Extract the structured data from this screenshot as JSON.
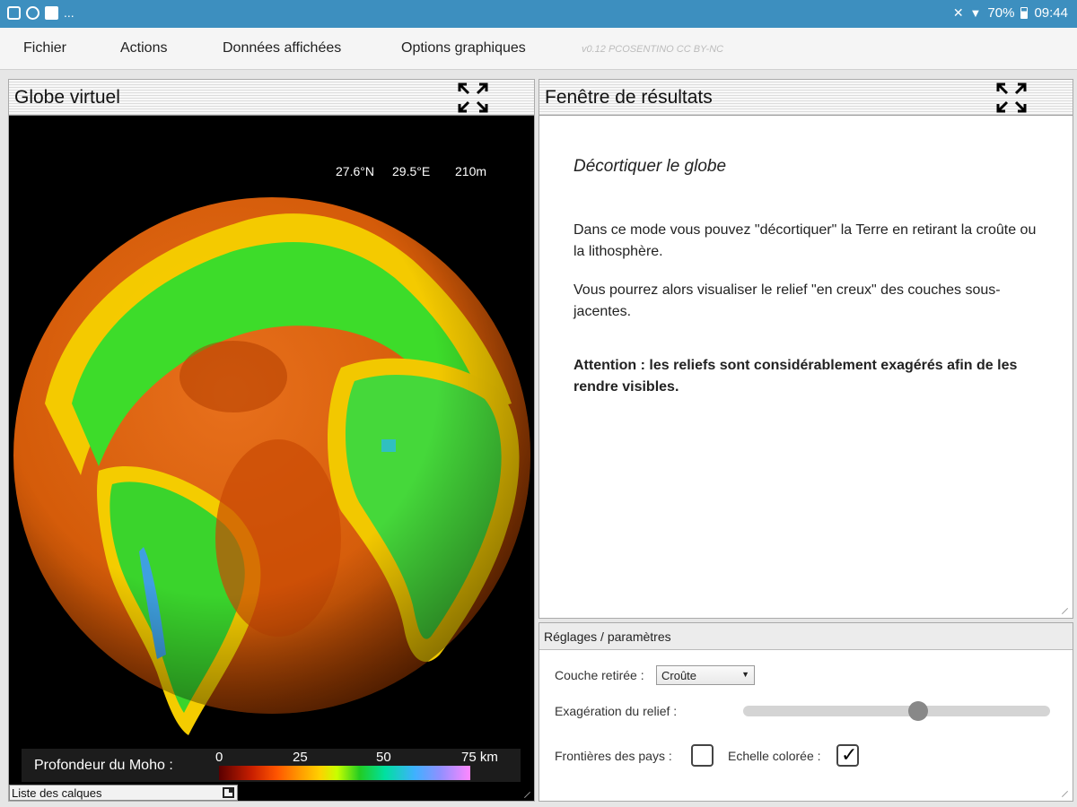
{
  "status_bar": {
    "notification_overflow": "...",
    "battery_percent": "70%",
    "time": "09:44"
  },
  "menu": {
    "items": [
      "Fichier",
      "Actions",
      "Données affichées",
      "Options graphiques"
    ],
    "version": "v0.12 PCOSENTINO CC BY-NC"
  },
  "globe_panel": {
    "title": "Globe virtuel",
    "coords": {
      "lat": "27.6°N",
      "lon": "29.5°E",
      "alt": "210m"
    },
    "legend": {
      "label": "Profondeur du Moho :",
      "ticks": [
        "0",
        "25",
        "50",
        "75 km"
      ]
    },
    "layers_label": "Liste des calques"
  },
  "results_panel": {
    "title": "Fenêtre de résultats",
    "heading": "Décortiquer le globe",
    "paragraphs": [
      "Dans ce mode vous pouvez \"décortiquer\" la Terre en retirant la croûte ou la lithosphère.",
      "Vous pourrez alors visualiser le relief \"en creux\" des couches sous-jacentes."
    ],
    "warning": "Attention : les reliefs sont considérablement exagérés afin de les rendre visibles."
  },
  "settings_panel": {
    "title": "Réglages / paramètres",
    "layer_removed_label": "Couche retirée :",
    "layer_removed_value": "Croûte",
    "relief_label": "Exagération du relief :",
    "relief_value": 0.57,
    "borders_label": "Frontières des pays :",
    "borders_checked": false,
    "color_scale_label": "Echelle colorée :",
    "color_scale_checked": true
  },
  "colors": {
    "status_bar": "#3d8fbf",
    "ocean_crust": "#e06a10",
    "continent_green": "#3ddc2a"
  }
}
